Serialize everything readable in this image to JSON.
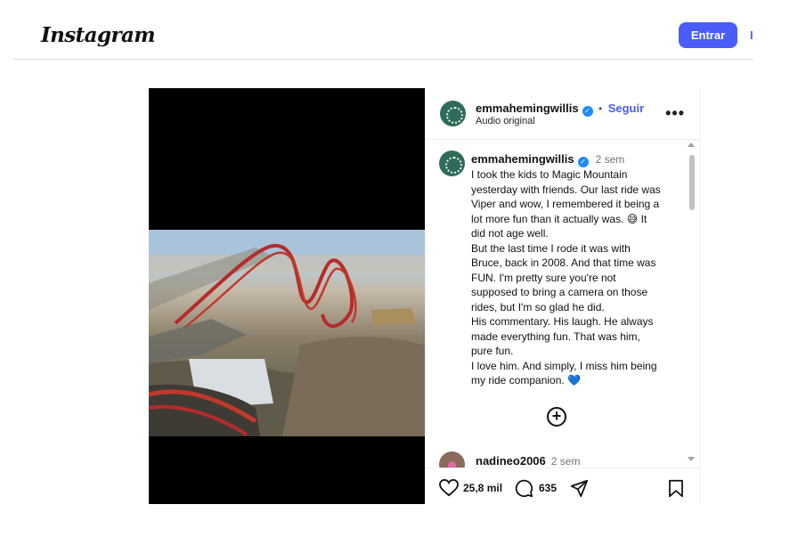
{
  "header": {
    "logo": "Instagram",
    "login_label": "Entrar",
    "cut_link": "I"
  },
  "post": {
    "username": "emmahemingwillis",
    "follow_label": "Seguir",
    "separator": "•",
    "audio": "Audio original",
    "caption_time": "2 sem",
    "caption_lines": [
      "I took the kids to Magic Mountain",
      "yesterday with friends. Our last ride was",
      "Viper and wow, I remembered it being a",
      "lot more fun than it actually was. 😅 It",
      "did not age well.",
      "But the last time I rode it was with",
      "Bruce, back in 2008. And that time was",
      "FUN. I'm pretty sure you're not",
      "supposed to bring a camera on those",
      "rides, but I'm so glad he did.",
      "His commentary. His laugh. He always",
      "made everything fun. That was him,",
      "pure fun.",
      "I love him. And simply, I miss him being",
      "my ride companion. 💙"
    ]
  },
  "comment": {
    "username": "nadineo2006",
    "time": "2 sem"
  },
  "actions": {
    "likes": "25,8 mil",
    "comments": "635"
  },
  "colors": {
    "accent": "#4a5df9",
    "verified": "#1d8cf8"
  },
  "icons": [
    "heart-icon",
    "comment-icon",
    "share-icon",
    "bookmark-icon",
    "more-icon",
    "add-comment-icon",
    "verified-icon"
  ]
}
